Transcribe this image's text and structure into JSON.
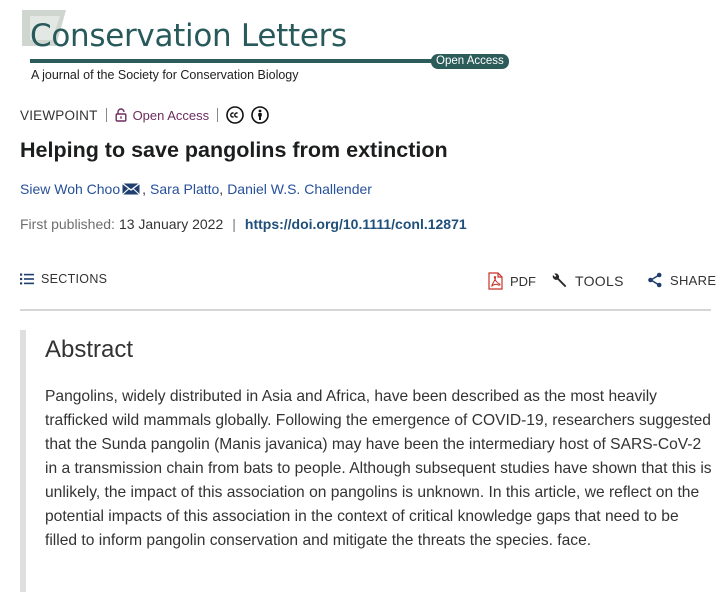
{
  "journal": {
    "title": "Conservation Letters",
    "access_badge": "Open Access",
    "subtitle": "A journal of the Society for Conservation Biology"
  },
  "article": {
    "type": "VIEWPOINT",
    "access": "Open Access",
    "license_icons": [
      "creative-commons-icon",
      "attribution-icon"
    ],
    "title": "Helping to save pangolins from extinction",
    "authors": [
      "Siew Woh Choo",
      "Sara Platto",
      "Daniel W.S. Challender"
    ],
    "published_label": "First published:",
    "published_date": "13 January 2022",
    "separator": "|",
    "doi": "https://doi.org/10.1111/conl.12871"
  },
  "toolbar": {
    "sections_label": "SECTIONS",
    "pdf_label": "PDF",
    "tools_label": "TOOLS",
    "share_label": "SHARE"
  },
  "abstract": {
    "heading": "Abstract",
    "text": "Pangolins, widely distributed in Asia and Africa, have been described as the most heavily trafficked wild mammals globally. Following the emergence of COVID-19, researchers suggested that the Sunda pangolin (Manis javanica) may have been the intermediary host of SARS-CoV-2 in a transmission chain from bats to people. Although subsequent studies have shown that this is unlikely, the impact of this association on pangolins is unknown. In this article, we reflect on the potential impacts of this association in the context of critical knowledge gaps that need to be filled to inform pangolin conservation and mitigate the threats the species. face."
  },
  "colors": {
    "journal_green": "#295a5b",
    "open_access_purple": "#6b2c5f",
    "author_link": "#27509b",
    "doi_link": "#1f4f7a",
    "pdf_red": "#c8322b"
  }
}
